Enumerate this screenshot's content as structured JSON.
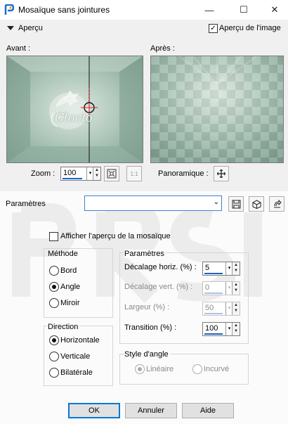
{
  "window": {
    "title": "Mosaïque sans jointures",
    "minimize_glyph": "—",
    "maximize_glyph": "☐",
    "close_glyph": "✕"
  },
  "preview_bar": {
    "toggle_label": "Aperçu",
    "image_preview_label": "Aperçu de l'image",
    "image_preview_checked": true
  },
  "before": {
    "label": "Avant :",
    "watermark": "Cloclo"
  },
  "after": {
    "label": "Après :"
  },
  "zoom": {
    "label": "Zoom :",
    "value": "100",
    "fit_icon": "fit-icon",
    "one_to_one": "1:1"
  },
  "pan": {
    "label": "Panoramique :"
  },
  "presets": {
    "label": "Paramètres",
    "value": ""
  },
  "options": {
    "show_tile_preview": "Afficher l'aperçu de la mosaïque",
    "show_tile_preview_checked": false
  },
  "method": {
    "title": "Méthode",
    "options": [
      {
        "label": "Bord"
      },
      {
        "label": "Angle"
      },
      {
        "label": "Miroir"
      }
    ],
    "selected": "Angle"
  },
  "direction": {
    "title": "Direction",
    "options": [
      {
        "label": "Horizontale"
      },
      {
        "label": "Verticale"
      },
      {
        "label": "Bilatérale"
      }
    ],
    "selected": "Horizontale"
  },
  "params": {
    "title": "Paramètres",
    "fields": [
      {
        "label": "Décalage horiz. (%) :",
        "value": "5",
        "enabled": true
      },
      {
        "label": "Décalage vert. (%) :",
        "value": "0",
        "enabled": false
      },
      {
        "label": "Largeur (%) :",
        "value": "50",
        "enabled": false
      },
      {
        "label": "Transition (%) :",
        "value": "100",
        "enabled": true
      }
    ]
  },
  "corner_style": {
    "title": "Style d'angle",
    "options": [
      {
        "label": "Linéaire"
      },
      {
        "label": "Incurvé"
      }
    ],
    "selected": "Linéaire",
    "enabled": false
  },
  "buttons": {
    "ok": "OK",
    "cancel": "Annuler",
    "help": "Aide"
  },
  "colors": {
    "accent": "#0078d7",
    "preview_green": "#9ab6a6",
    "crosshair": "#e81818"
  }
}
